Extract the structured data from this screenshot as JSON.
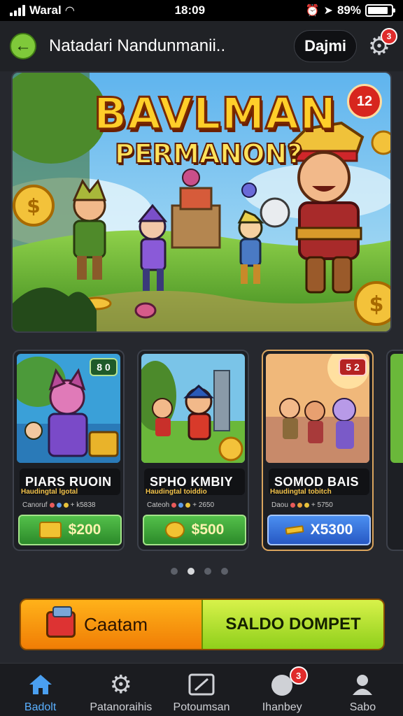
{
  "status_bar": {
    "carrier": "Waral",
    "time": "18:09",
    "battery": "89%",
    "battery_level": 0.89
  },
  "header": {
    "title": "Natadari Nandunmanii..",
    "chip_label": "Dajmi",
    "settings_badge": "3"
  },
  "hero": {
    "title": "BAVLMAN",
    "subtitle": "PERMANON?",
    "badge": "12"
  },
  "cards": [
    {
      "name": "PIARS RUOIN",
      "subtitle": "Haudingtal lgotal",
      "meta_label": "Canoruf",
      "meta_value": "+ k5838",
      "badge": "8 0",
      "price": "$200",
      "button_style": "green",
      "icon": "treasure-chest-icon"
    },
    {
      "name": "SPHO KMBIY",
      "subtitle": "Haudingtal toiddio",
      "meta_label": "Cateoh",
      "meta_value": "+ 2650",
      "badge": "",
      "price": "$500",
      "button_style": "green",
      "icon": "gold-coin-icon"
    },
    {
      "name": "SOMOD BAIS",
      "subtitle": "Haudingtal tobitch",
      "meta_label": "Daou",
      "meta_value": "+ 5750",
      "badge": "5 2",
      "price": "X5300",
      "button_style": "blue",
      "icon": "cash-icon"
    }
  ],
  "cta": {
    "left_label": "Caatam",
    "right_label": "SALDO DOMPET"
  },
  "bottom_nav": [
    {
      "label": "Badolt",
      "icon": "home-icon",
      "active": true
    },
    {
      "label": "Patanoraihis",
      "icon": "gear-icon",
      "active": false
    },
    {
      "label": "Potoumsan",
      "icon": "edit-icon",
      "active": false
    },
    {
      "label": "Ihanbey",
      "icon": "chat-icon",
      "active": false,
      "badge": "3"
    },
    {
      "label": "Sabo",
      "icon": "profile-icon",
      "active": false
    }
  ],
  "colors": {
    "background": "#26282e",
    "accent_green": "#7fc93a",
    "accent_orange": "#f07d05",
    "accent_lime": "#b8e33a",
    "badge_red": "#e02b2b",
    "nav_active": "#5ab0ff"
  }
}
